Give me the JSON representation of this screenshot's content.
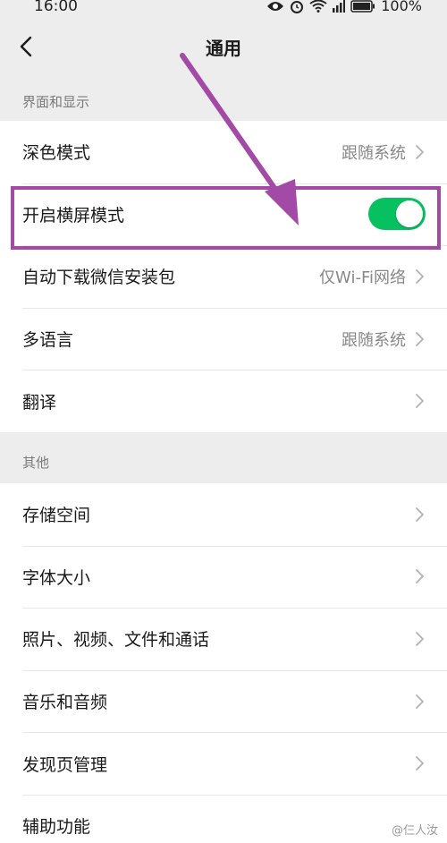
{
  "status_bar": {
    "time": "16:00",
    "battery": "100%",
    "icons": [
      "eye-icon",
      "alarm-icon",
      "wifi-icon",
      "signal-icon",
      "battery-icon"
    ]
  },
  "header": {
    "title": "通用",
    "back_icon": "chevron-left-icon"
  },
  "sections": [
    {
      "label": "界面和显示",
      "rows": [
        {
          "label": "深色模式",
          "value": "跟随系统"
        },
        {
          "label": "开启横屏模式",
          "toggle": true
        },
        {
          "label": "自动下载微信安装包",
          "value": "仅Wi-Fi网络"
        },
        {
          "label": "多语言",
          "value": "跟随系统"
        },
        {
          "label": "翻译",
          "value": ""
        }
      ]
    },
    {
      "label": "其他",
      "rows": [
        {
          "label": "存储空间"
        },
        {
          "label": "字体大小"
        },
        {
          "label": "照片、视频、文件和通话"
        },
        {
          "label": "音乐和音频"
        },
        {
          "label": "发现页管理"
        },
        {
          "label": "辅助功能"
        }
      ]
    }
  ],
  "annotation": {
    "color": "#a24aa6",
    "highlight_target": "开启横屏模式"
  },
  "watermark": "@仨人汝",
  "colors": {
    "toggle_on": "#07c160",
    "background": "#ededed"
  }
}
